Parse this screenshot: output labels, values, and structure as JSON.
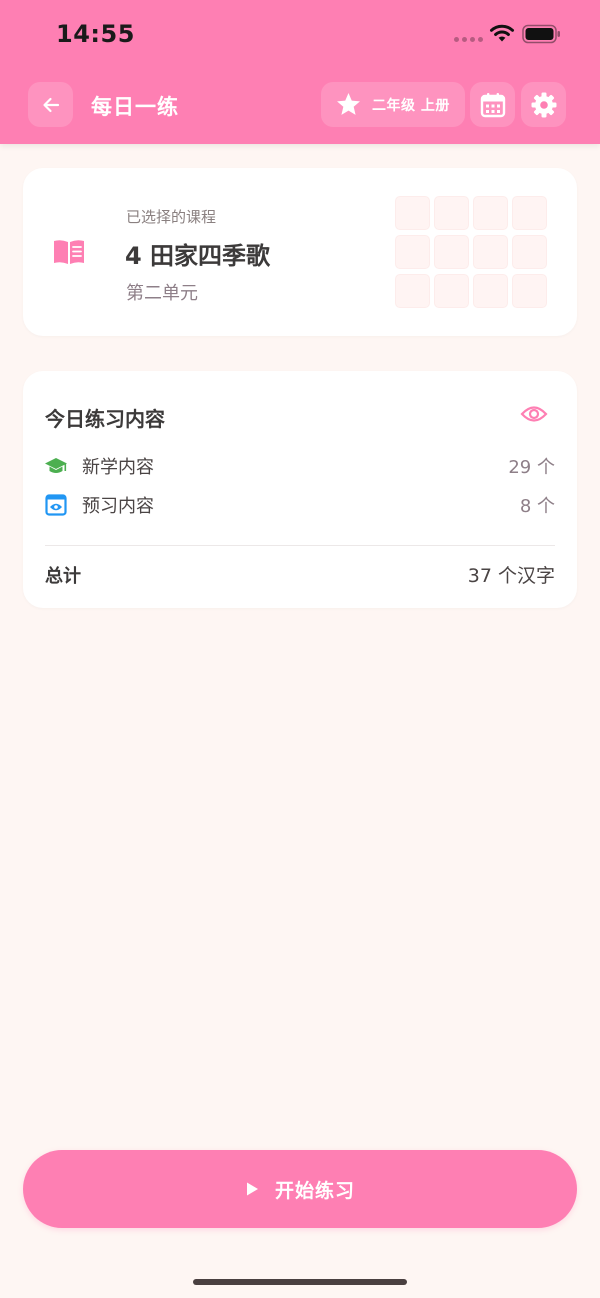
{
  "status_bar": {
    "time": "14:55"
  },
  "header": {
    "title": "每日一练",
    "grade": "二年级 上册",
    "icons": {
      "back": "arrow-left-icon",
      "star": "star-icon",
      "calendar": "calendar-icon",
      "settings": "gear-icon"
    }
  },
  "course": {
    "caption": "已选择的课程",
    "title": "4 田家四季歌",
    "unit": "第二单元",
    "icon": "open-book-icon"
  },
  "today": {
    "title": "今日练习内容",
    "rows": [
      {
        "label": "新学内容",
        "count": "29 个",
        "icon": "graduation-cap-icon"
      },
      {
        "label": "预习内容",
        "count": "8 个",
        "icon": "preview-eye-icon"
      }
    ],
    "total_label": "总计",
    "total_value": "37 个汉字"
  },
  "start_button": {
    "label": "开始练习"
  },
  "colors": {
    "primary": "#fe7fb3",
    "background": "#fef6f3",
    "green": "#4caf50",
    "blue": "#2196f3"
  }
}
